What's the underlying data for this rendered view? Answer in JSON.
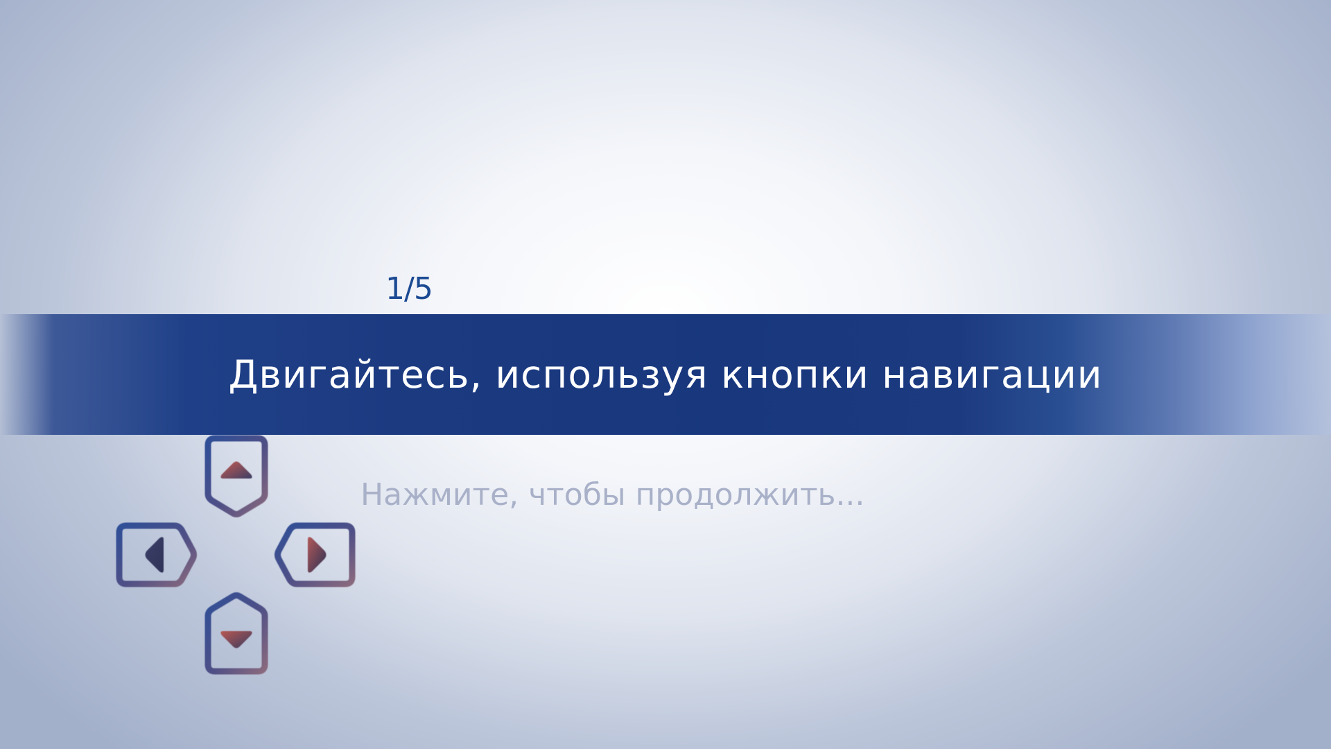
{
  "tutorial": {
    "step_counter": "1/5",
    "instruction": "Двигайтесь, используя кнопки навигации",
    "continue_hint": "Нажмите, чтобы продолжить..."
  },
  "dpad": {
    "icons": [
      "arrow-up-icon",
      "arrow-left-icon",
      "arrow-right-icon",
      "arrow-down-icon"
    ]
  },
  "colors": {
    "banner": "#1c3a80",
    "counter": "#1c4a93",
    "hint": "#a9b1c9",
    "dpad_outline_blue": "#2f4f98",
    "dpad_outline_mauve": "#8a6a7e",
    "arrow_red": "#b55a5a",
    "arrow_navy": "#333a60"
  }
}
